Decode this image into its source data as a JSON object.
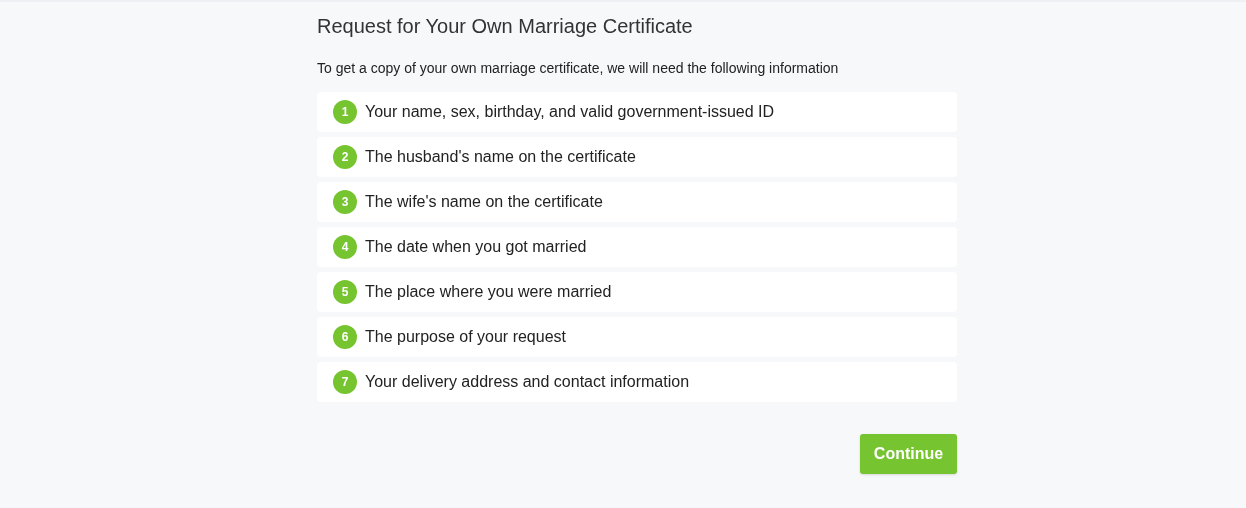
{
  "title": "Request for Your Own Marriage Certificate",
  "intro": "To get a copy of your own marriage certificate, we will need the following information",
  "items": [
    {
      "number": "1",
      "text": "Your name, sex, birthday, and valid government-issued ID"
    },
    {
      "number": "2",
      "text": "The husband's name on the certificate"
    },
    {
      "number": "3",
      "text": "The wife's name on the certificate"
    },
    {
      "number": "4",
      "text": "The date when you got married"
    },
    {
      "number": "5",
      "text": "The place where you were married"
    },
    {
      "number": "6",
      "text": "The purpose of your request"
    },
    {
      "number": "7",
      "text": "Your delivery address and contact information"
    }
  ],
  "button": "Continue"
}
